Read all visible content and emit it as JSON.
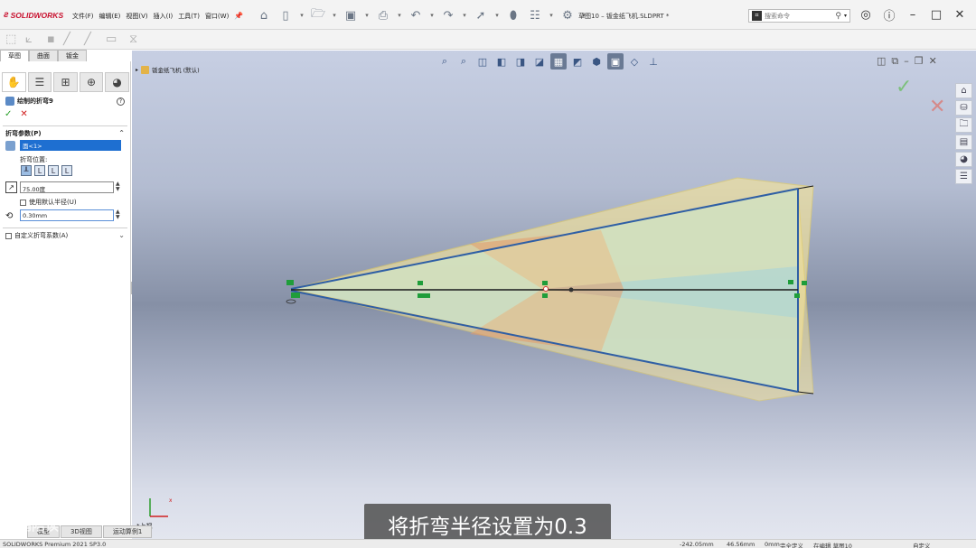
{
  "app": {
    "logo": "SOLIDWORKS",
    "menus": [
      "文件(F)",
      "编辑(E)",
      "视图(V)",
      "插入(I)",
      "工具(T)",
      "窗口(W)"
    ],
    "doc_title": "草图10 – 钣金纸飞机.SLDPRT *",
    "search_placeholder": "搜索命令"
  },
  "tabs": [
    "草图",
    "曲面",
    "钣金"
  ],
  "property_manager": {
    "feature_title": "绘制的折弯9",
    "help": "?",
    "section_bend_params": "折弯参数(P)",
    "face_selection": "面<1>",
    "bend_position_label": "折弯位置:",
    "angle_value": "75.00度",
    "use_default_radius": "使用默认半径(U)",
    "radius_value": "0.30mm",
    "custom_allowance": "自定义折弯系数(A)"
  },
  "viewport": {
    "tree_label": "钣金纸飞机 (默认)",
    "view_label": "*上视",
    "subtitle": "将折弯半径设置为0.3",
    "watermark": "大鹏陪读"
  },
  "bottom_tabs": [
    "模型",
    "3D视图",
    "运动算例1"
  ],
  "status_bar": {
    "product": "SOLIDWORKS Premium 2021 SP3.0",
    "x": "-242.05mm",
    "y": "46.56mm",
    "z": "0mm",
    "state": "完全定义",
    "editing": "在编辑 草图10",
    "custom": "自定义"
  },
  "colors": {
    "accent_red": "#c8102e",
    "selection_blue": "#1e6fd1",
    "model_edge": "#2f5fa5",
    "ok_green": "#2aa02a",
    "cancel_red": "#d02020"
  }
}
